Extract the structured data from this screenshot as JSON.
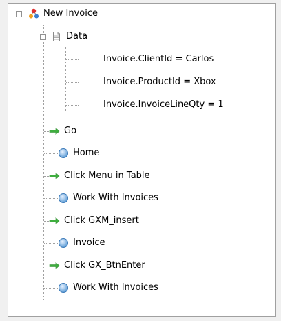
{
  "tree": {
    "root": {
      "label": "New Invoice",
      "icon": "flowchart-icon",
      "expanded": true,
      "children": {
        "data_node": {
          "label": "Data",
          "icon": "document-icon",
          "expanded": true,
          "items": [
            "Invoice.ClientId = Carlos",
            "Invoice.ProductId = Xbox",
            "Invoice.InvoiceLineQty = 1"
          ]
        },
        "steps": [
          {
            "label": "Go",
            "icon": "green-arrow-icon"
          },
          {
            "label": "Home",
            "icon": "blue-circle-icon"
          },
          {
            "label": "Click Menu in Table",
            "icon": "green-arrow-icon"
          },
          {
            "label": "Work With Invoices",
            "icon": "blue-circle-icon"
          },
          {
            "label": "Click GXM_insert",
            "icon": "green-arrow-icon"
          },
          {
            "label": "Invoice",
            "icon": "blue-circle-icon"
          },
          {
            "label": "Click GX_BtnEnter",
            "icon": "green-arrow-icon"
          },
          {
            "label": "Work With Invoices",
            "icon": "blue-circle-icon"
          }
        ]
      }
    }
  },
  "colors": {
    "panel_bg": "#ffffff",
    "window_bg": "#f0f0f0",
    "arrow_green": "#3fae3f",
    "circle_blue": "#5b9bd5",
    "tree_line": "#a0a0a0"
  }
}
